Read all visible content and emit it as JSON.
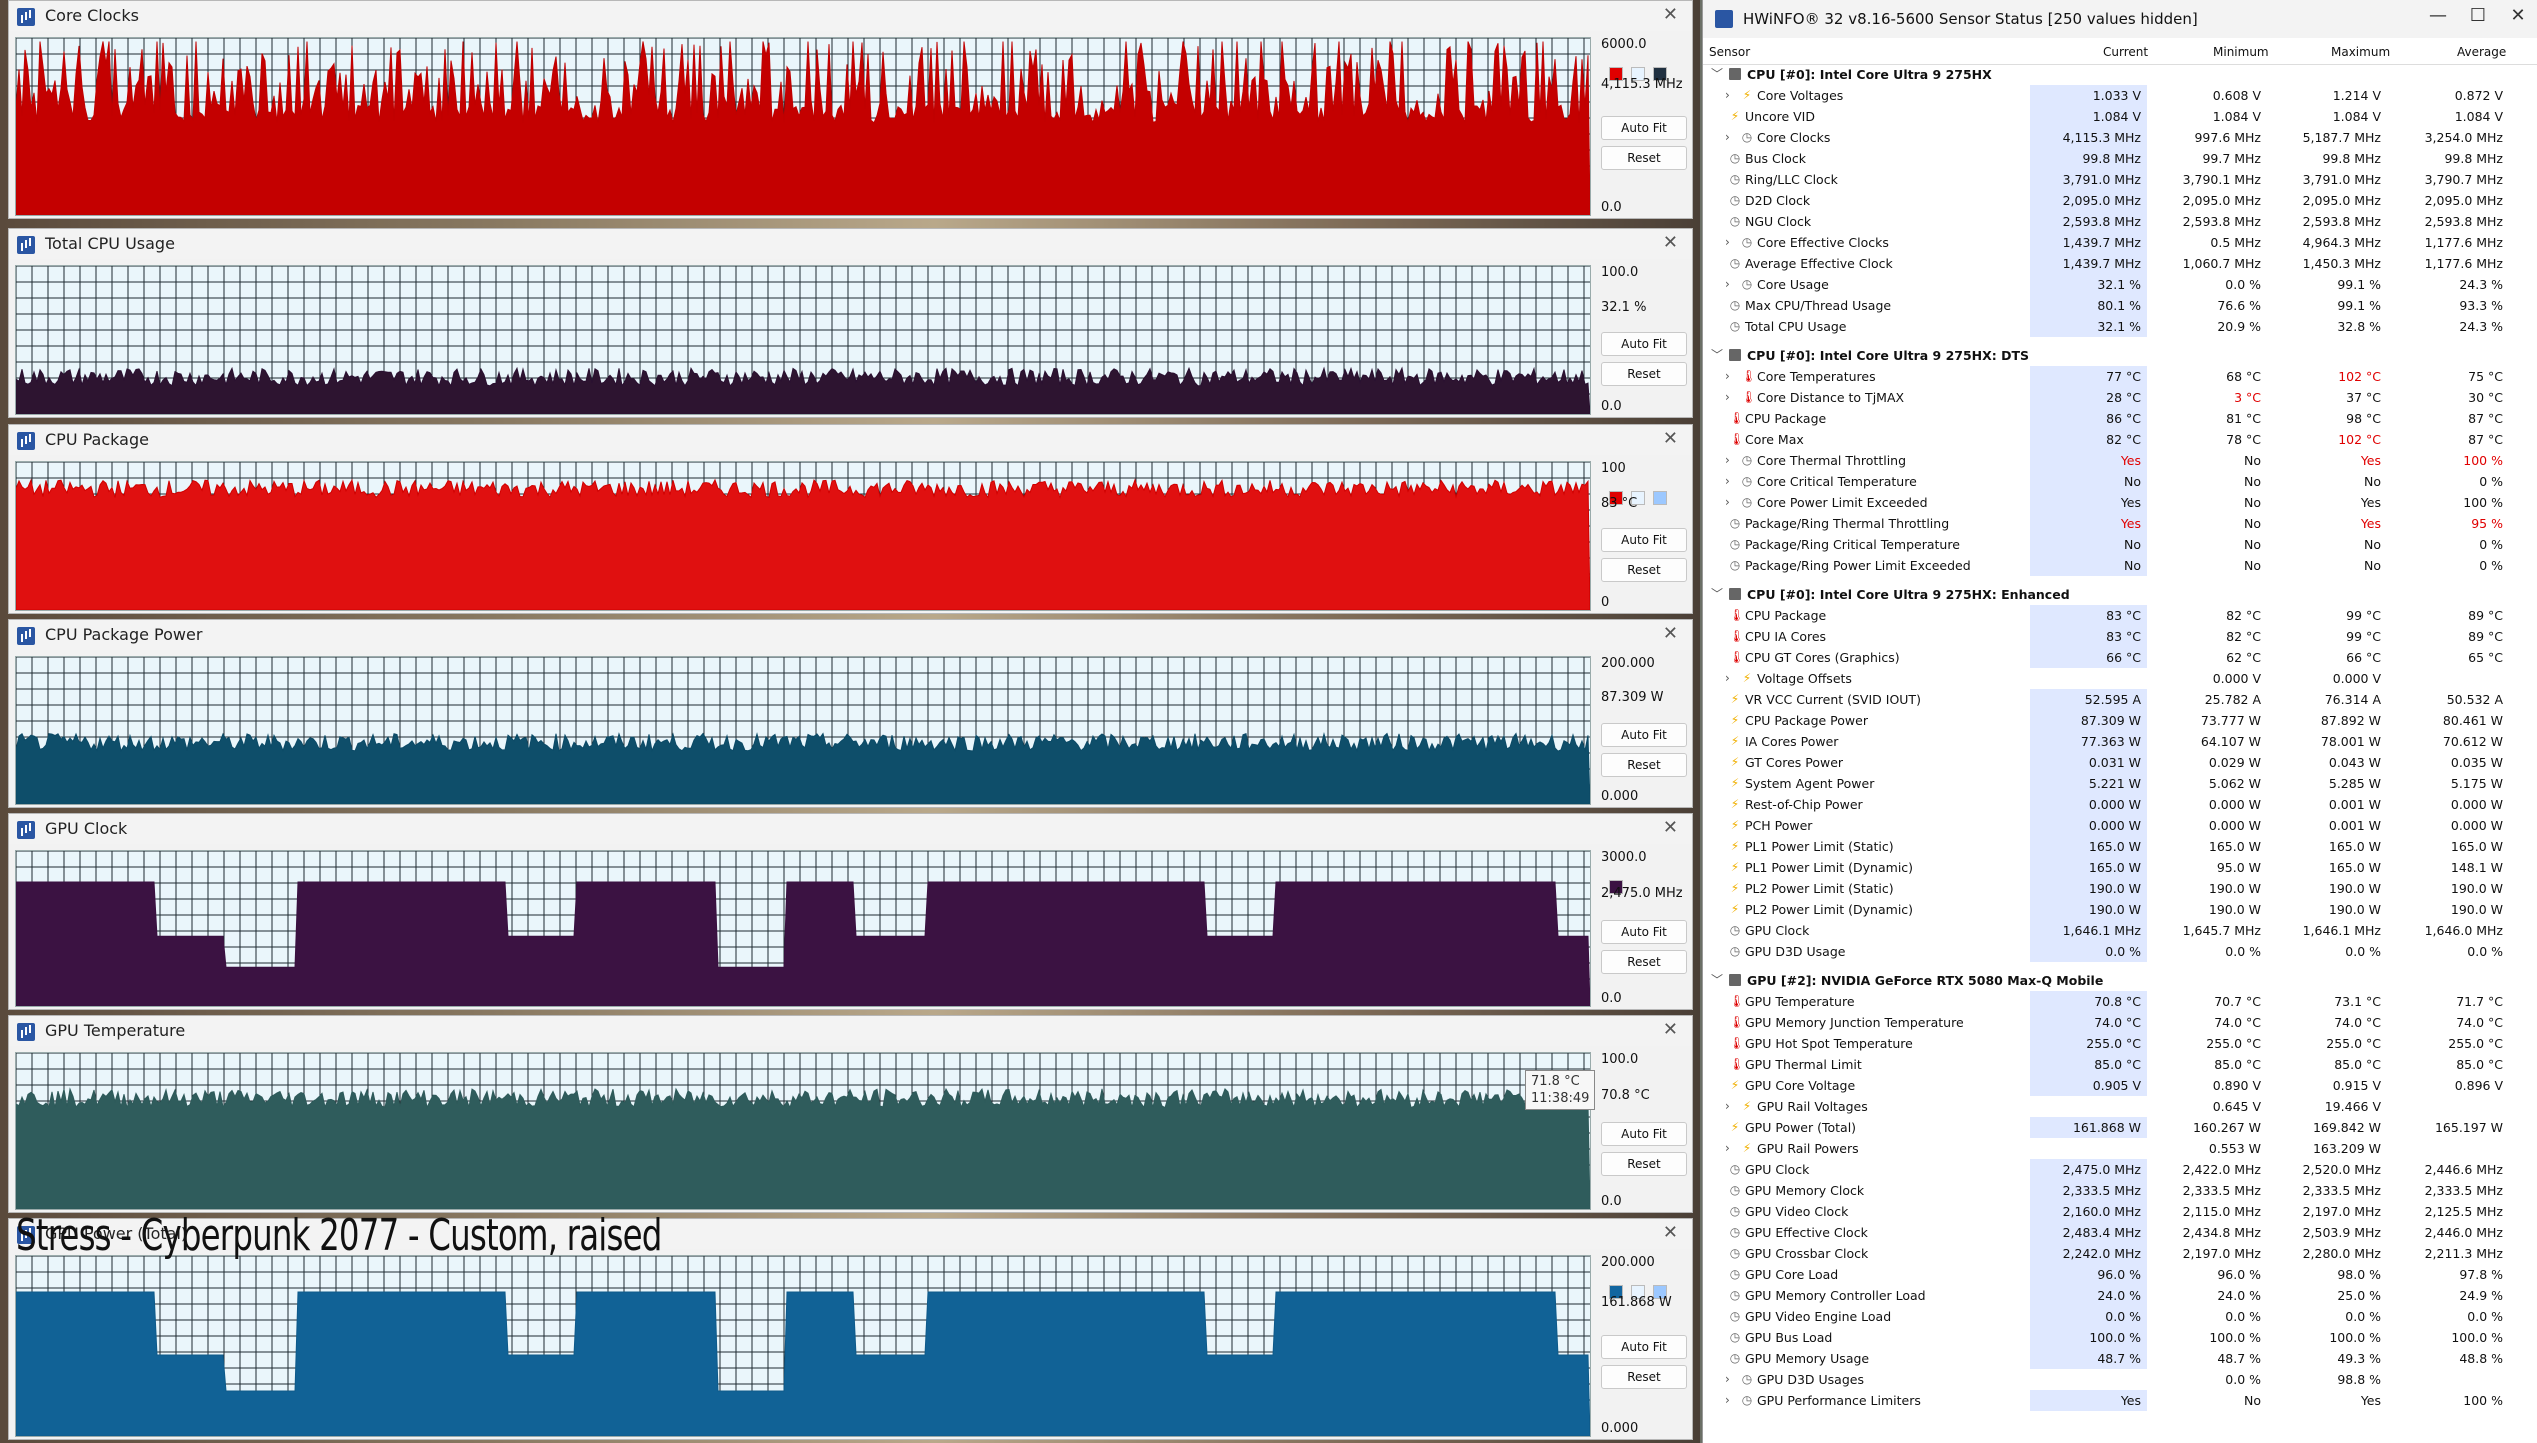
{
  "graphs": [
    {
      "title": "Core Clocks",
      "max": "6000.0",
      "current": "4,115.3 MHz",
      "min": "0.0",
      "color": "#c00000",
      "fill": "#c40000",
      "level": 0.62,
      "swatches": [
        "#e00000",
        "#e8f4ff",
        "#203040"
      ]
    },
    {
      "title": "Total CPU Usage",
      "max": "100.0",
      "current": "32.1 %",
      "min": "0.0",
      "color": "#2a1030",
      "fill": "#2d1430",
      "level": 0.25,
      "swatches": []
    },
    {
      "title": "CPU Package",
      "max": "100",
      "current": "83 °C",
      "min": "0",
      "color": "#d00000",
      "fill": "#e01010",
      "level": 0.82,
      "swatches": [
        "#e00000",
        "#e8f4ff",
        "#9cc8ff"
      ]
    },
    {
      "title": "CPU Package Power",
      "max": "200.000",
      "current": "87.309 W",
      "min": "0.000",
      "color": "#0c4a66",
      "fill": "#0e4e6a",
      "level": 0.42,
      "swatches": []
    },
    {
      "title": "GPU Clock",
      "max": "3000.0",
      "current": "2,475.0 MHz",
      "min": "0.0",
      "color": "#3a1040",
      "fill": "#3b1242",
      "level": 0.8,
      "swatches": [
        "#3b1242"
      ]
    },
    {
      "title": "GPU Temperature",
      "max": "100.0",
      "current": "70.8 °C",
      "min": "0.0",
      "color": "#2e5a5a",
      "fill": "#2f5c5c",
      "level": 0.71,
      "swatches": []
    },
    {
      "title": "GPU Power (Total)",
      "max": "200.000",
      "current": "161.868 W",
      "min": "0.000",
      "color": "#0e5a8a",
      "fill": "#116296",
      "level": 0.8,
      "swatches": [
        "#1266a0",
        "#e8f4ff",
        "#9cc8ff"
      ]
    }
  ],
  "buttons": {
    "autofit": "Auto Fit",
    "reset": "Reset"
  },
  "tooltip": {
    "value": "71.8 °C",
    "time": "11:38:49"
  },
  "overlay_text": "Stress - Cyberpunk 2077 - Custom, raised",
  "hwinfo": {
    "title": "HWiNFO® 32 v8.16-5600 Sensor Status [250 values hidden]",
    "columns": [
      "Sensor",
      "Current",
      "Minimum",
      "Maximum",
      "Average"
    ],
    "rows": [
      {
        "type": "hdr",
        "label": "CPU [#0]: Intel Core Ultra 9 275HX"
      },
      {
        "icon": "volt",
        "exp": true,
        "label": "Core Voltages",
        "cur": "1.033 V",
        "min": "0.608 V",
        "max": "1.214 V",
        "avg": "0.872 V"
      },
      {
        "icon": "volt",
        "label": "Uncore VID",
        "cur": "1.084 V",
        "min": "1.084 V",
        "max": "1.084 V",
        "avg": "1.084 V"
      },
      {
        "icon": "clock",
        "exp": true,
        "label": "Core Clocks",
        "cur": "4,115.3 MHz",
        "min": "997.6 MHz",
        "max": "5,187.7 MHz",
        "avg": "3,254.0 MHz"
      },
      {
        "icon": "clock",
        "label": "Bus Clock",
        "cur": "99.8 MHz",
        "min": "99.7 MHz",
        "max": "99.8 MHz",
        "avg": "99.8 MHz"
      },
      {
        "icon": "clock",
        "label": "Ring/LLC Clock",
        "cur": "3,791.0 MHz",
        "min": "3,790.1 MHz",
        "max": "3,791.0 MHz",
        "avg": "3,790.7 MHz"
      },
      {
        "icon": "clock",
        "label": "D2D Clock",
        "cur": "2,095.0 MHz",
        "min": "2,095.0 MHz",
        "max": "2,095.0 MHz",
        "avg": "2,095.0 MHz"
      },
      {
        "icon": "clock",
        "label": "NGU Clock",
        "cur": "2,593.8 MHz",
        "min": "2,593.8 MHz",
        "max": "2,593.8 MHz",
        "avg": "2,593.8 MHz"
      },
      {
        "icon": "clock",
        "exp": true,
        "label": "Core Effective Clocks",
        "cur": "1,439.7 MHz",
        "min": "0.5 MHz",
        "max": "4,964.3 MHz",
        "avg": "1,177.6 MHz"
      },
      {
        "icon": "clock",
        "label": "Average Effective Clock",
        "cur": "1,439.7 MHz",
        "min": "1,060.7 MHz",
        "max": "1,450.3 MHz",
        "avg": "1,177.6 MHz"
      },
      {
        "icon": "clock",
        "exp": true,
        "label": "Core Usage",
        "cur": "32.1 %",
        "min": "0.0 %",
        "max": "99.1 %",
        "avg": "24.3 %"
      },
      {
        "icon": "clock",
        "label": "Max CPU/Thread Usage",
        "cur": "80.1 %",
        "min": "76.6 %",
        "max": "99.1 %",
        "avg": "93.3 %"
      },
      {
        "icon": "clock",
        "label": "Total CPU Usage",
        "cur": "32.1 %",
        "min": "20.9 %",
        "max": "32.8 %",
        "avg": "24.3 %"
      },
      {
        "type": "gap"
      },
      {
        "type": "hdr",
        "label": "CPU [#0]: Intel Core Ultra 9 275HX: DTS"
      },
      {
        "icon": "temp",
        "exp": true,
        "label": "Core Temperatures",
        "cur": "77 °C",
        "min": "68 °C",
        "max": "102 °C",
        "avg": "75 °C",
        "maxred": true
      },
      {
        "icon": "temp",
        "exp": true,
        "label": "Core Distance to TjMAX",
        "cur": "28 °C",
        "min": "3 °C",
        "max": "37 °C",
        "avg": "30 °C",
        "minred": true
      },
      {
        "icon": "temp",
        "label": "CPU Package",
        "cur": "86 °C",
        "min": "81 °C",
        "max": "98 °C",
        "avg": "87 °C"
      },
      {
        "icon": "temp",
        "label": "Core Max",
        "cur": "82 °C",
        "min": "78 °C",
        "max": "102 °C",
        "avg": "87 °C",
        "maxred": true
      },
      {
        "icon": "clock",
        "exp": true,
        "label": "Core Thermal Throttling",
        "cur": "Yes",
        "min": "No",
        "max": "Yes",
        "avg": "100 %",
        "curred": true,
        "maxred": true,
        "avgred": true
      },
      {
        "icon": "clock",
        "exp": true,
        "label": "Core Critical Temperature",
        "cur": "No",
        "min": "No",
        "max": "No",
        "avg": "0 %"
      },
      {
        "icon": "clock",
        "exp": true,
        "label": "Core Power Limit Exceeded",
        "cur": "Yes",
        "min": "No",
        "max": "Yes",
        "avg": "100 %"
      },
      {
        "icon": "clock",
        "label": "Package/Ring Thermal Throttling",
        "cur": "Yes",
        "min": "No",
        "max": "Yes",
        "avg": "95 %",
        "curred": true,
        "maxred": true,
        "avgred": true
      },
      {
        "icon": "clock",
        "label": "Package/Ring Critical Temperature",
        "cur": "No",
        "min": "No",
        "max": "No",
        "avg": "0 %"
      },
      {
        "icon": "clock",
        "label": "Package/Ring Power Limit Exceeded",
        "cur": "No",
        "min": "No",
        "max": "No",
        "avg": "0 %"
      },
      {
        "type": "gap"
      },
      {
        "type": "hdr",
        "label": "CPU [#0]: Intel Core Ultra 9 275HX: Enhanced"
      },
      {
        "icon": "temp",
        "label": "CPU Package",
        "cur": "83 °C",
        "min": "82 °C",
        "max": "99 °C",
        "avg": "89 °C"
      },
      {
        "icon": "temp",
        "label": "CPU IA Cores",
        "cur": "83 °C",
        "min": "82 °C",
        "max": "99 °C",
        "avg": "89 °C"
      },
      {
        "icon": "temp",
        "label": "CPU GT Cores (Graphics)",
        "cur": "66 °C",
        "min": "62 °C",
        "max": "66 °C",
        "avg": "65 °C"
      },
      {
        "icon": "volt",
        "exp": true,
        "label": "Voltage Offsets",
        "cur": "",
        "min": "0.000 V",
        "max": "0.000 V",
        "avg": ""
      },
      {
        "icon": "volt",
        "label": "VR VCC Current (SVID IOUT)",
        "cur": "52.595 A",
        "min": "25.782 A",
        "max": "76.314 A",
        "avg": "50.532 A"
      },
      {
        "icon": "volt",
        "label": "CPU Package Power",
        "cur": "87.309 W",
        "min": "73.777 W",
        "max": "87.892 W",
        "avg": "80.461 W"
      },
      {
        "icon": "volt",
        "label": "IA Cores Power",
        "cur": "77.363 W",
        "min": "64.107 W",
        "max": "78.001 W",
        "avg": "70.612 W"
      },
      {
        "icon": "volt",
        "label": "GT Cores Power",
        "cur": "0.031 W",
        "min": "0.029 W",
        "max": "0.043 W",
        "avg": "0.035 W"
      },
      {
        "icon": "volt",
        "label": "System Agent Power",
        "cur": "5.221 W",
        "min": "5.062 W",
        "max": "5.285 W",
        "avg": "5.175 W"
      },
      {
        "icon": "volt",
        "label": "Rest-of-Chip Power",
        "cur": "0.000 W",
        "min": "0.000 W",
        "max": "0.001 W",
        "avg": "0.000 W"
      },
      {
        "icon": "volt",
        "label": "PCH Power",
        "cur": "0.000 W",
        "min": "0.000 W",
        "max": "0.001 W",
        "avg": "0.000 W"
      },
      {
        "icon": "volt",
        "label": "PL1 Power Limit (Static)",
        "cur": "165.0 W",
        "min": "165.0 W",
        "max": "165.0 W",
        "avg": "165.0 W"
      },
      {
        "icon": "volt",
        "label": "PL1 Power Limit (Dynamic)",
        "cur": "165.0 W",
        "min": "95.0 W",
        "max": "165.0 W",
        "avg": "148.1 W"
      },
      {
        "icon": "volt",
        "label": "PL2 Power Limit (Static)",
        "cur": "190.0 W",
        "min": "190.0 W",
        "max": "190.0 W",
        "avg": "190.0 W"
      },
      {
        "icon": "volt",
        "label": "PL2 Power Limit (Dynamic)",
        "cur": "190.0 W",
        "min": "190.0 W",
        "max": "190.0 W",
        "avg": "190.0 W"
      },
      {
        "icon": "clock",
        "label": "GPU Clock",
        "cur": "1,646.1 MHz",
        "min": "1,645.7 MHz",
        "max": "1,646.1 MHz",
        "avg": "1,646.0 MHz"
      },
      {
        "icon": "clock",
        "label": "GPU D3D Usage",
        "cur": "0.0 %",
        "min": "0.0 %",
        "max": "0.0 %",
        "avg": "0.0 %"
      },
      {
        "type": "gap"
      },
      {
        "type": "hdr",
        "label": "GPU [#2]: NVIDIA  GeForce RTX 5080 Max-Q Mobile"
      },
      {
        "icon": "temp",
        "label": "GPU Temperature",
        "cur": "70.8 °C",
        "min": "70.7 °C",
        "max": "73.1 °C",
        "avg": "71.7 °C"
      },
      {
        "icon": "temp",
        "label": "GPU Memory Junction Temperature",
        "cur": "74.0 °C",
        "min": "74.0 °C",
        "max": "74.0 °C",
        "avg": "74.0 °C"
      },
      {
        "icon": "temp",
        "label": "GPU Hot Spot Temperature",
        "cur": "255.0 °C",
        "min": "255.0 °C",
        "max": "255.0 °C",
        "avg": "255.0 °C"
      },
      {
        "icon": "temp",
        "label": "GPU Thermal Limit",
        "cur": "85.0 °C",
        "min": "85.0 °C",
        "max": "85.0 °C",
        "avg": "85.0 °C"
      },
      {
        "icon": "volt",
        "label": "GPU Core Voltage",
        "cur": "0.905 V",
        "min": "0.890 V",
        "max": "0.915 V",
        "avg": "0.896 V"
      },
      {
        "icon": "volt",
        "exp": true,
        "label": "GPU Rail Voltages",
        "cur": "",
        "min": "0.645 V",
        "max": "19.466 V",
        "avg": ""
      },
      {
        "icon": "volt",
        "label": "GPU Power (Total)",
        "cur": "161.868 W",
        "min": "160.267 W",
        "max": "169.842 W",
        "avg": "165.197 W"
      },
      {
        "icon": "volt",
        "exp": true,
        "label": "GPU Rail Powers",
        "cur": "",
        "min": "0.553 W",
        "max": "163.209 W",
        "avg": ""
      },
      {
        "icon": "clock",
        "label": "GPU Clock",
        "cur": "2,475.0 MHz",
        "min": "2,422.0 MHz",
        "max": "2,520.0 MHz",
        "avg": "2,446.6 MHz"
      },
      {
        "icon": "clock",
        "label": "GPU Memory Clock",
        "cur": "2,333.5 MHz",
        "min": "2,333.5 MHz",
        "max": "2,333.5 MHz",
        "avg": "2,333.5 MHz"
      },
      {
        "icon": "clock",
        "label": "GPU Video Clock",
        "cur": "2,160.0 MHz",
        "min": "2,115.0 MHz",
        "max": "2,197.0 MHz",
        "avg": "2,125.5 MHz"
      },
      {
        "icon": "clock",
        "label": "GPU Effective Clock",
        "cur": "2,483.4 MHz",
        "min": "2,434.8 MHz",
        "max": "2,503.9 MHz",
        "avg": "2,446.0 MHz"
      },
      {
        "icon": "clock",
        "label": "GPU Crossbar Clock",
        "cur": "2,242.0 MHz",
        "min": "2,197.0 MHz",
        "max": "2,280.0 MHz",
        "avg": "2,211.3 MHz"
      },
      {
        "icon": "clock",
        "label": "GPU Core Load",
        "cur": "96.0 %",
        "min": "96.0 %",
        "max": "98.0 %",
        "avg": "97.8 %"
      },
      {
        "icon": "clock",
        "label": "GPU Memory Controller Load",
        "cur": "24.0 %",
        "min": "24.0 %",
        "max": "25.0 %",
        "avg": "24.9 %"
      },
      {
        "icon": "clock",
        "label": "GPU Video Engine Load",
        "cur": "0.0 %",
        "min": "0.0 %",
        "max": "0.0 %",
        "avg": "0.0 %"
      },
      {
        "icon": "clock",
        "label": "GPU Bus Load",
        "cur": "100.0 %",
        "min": "100.0 %",
        "max": "100.0 %",
        "avg": "100.0 %"
      },
      {
        "icon": "clock",
        "label": "GPU Memory Usage",
        "cur": "48.7 %",
        "min": "48.7 %",
        "max": "49.3 %",
        "avg": "48.8 %"
      },
      {
        "icon": "clock",
        "exp": true,
        "label": "GPU D3D Usages",
        "cur": "",
        "min": "0.0 %",
        "max": "98.8 %",
        "avg": ""
      },
      {
        "icon": "clock",
        "exp": true,
        "label": "GPU Performance Limiters",
        "cur": "Yes",
        "min": "No",
        "max": "Yes",
        "avg": "100 %"
      }
    ]
  }
}
